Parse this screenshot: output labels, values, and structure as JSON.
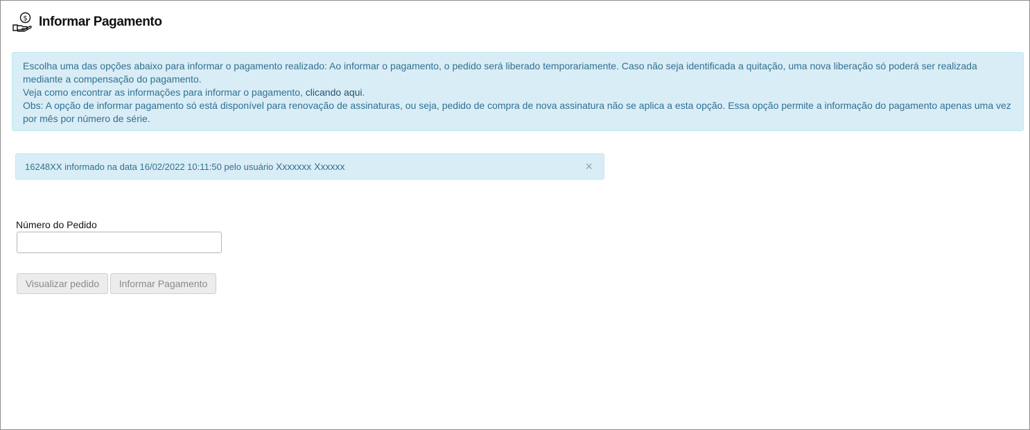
{
  "header": {
    "title": "Informar Pagamento",
    "icon": "hand-coin-icon"
  },
  "info_box": {
    "line1": "Escolha uma das opções abaixo para informar o pagamento realizado: Ao informar o pagamento, o pedido será liberado temporariamente. Caso não seja identificada a quitação, uma nova liberação só poderá ser realizada mediante a compensação do pagamento.",
    "line2_prefix": "Veja como encontrar as informações para informar o pagamento, ",
    "link_text": "clicando aqui",
    "line2_suffix": ".",
    "line3": "Obs: A opção de informar pagamento só está disponível para renovação de assinaturas, ou seja, pedido de compra de nova assinatura não se aplica a esta opção. Essa opção permite a informação do pagamento apenas uma vez por mês por número de série."
  },
  "notice": {
    "text": "16248XX informado na data 16/02/2022 10:11:50 pelo usuário ",
    "user": "Xxxxxxx Xxxxxx",
    "close": "×"
  },
  "form": {
    "order_label": "Número do Pedido",
    "order_value": "",
    "order_placeholder": "",
    "view_button": "Visualizar pedido",
    "pay_button": "Informar Pagamento"
  },
  "colors": {
    "info_bg": "#d9edf7",
    "info_border": "#bce8f1",
    "info_text": "#31708f",
    "button_bg": "#ececec",
    "button_text": "#8a8a8a"
  }
}
